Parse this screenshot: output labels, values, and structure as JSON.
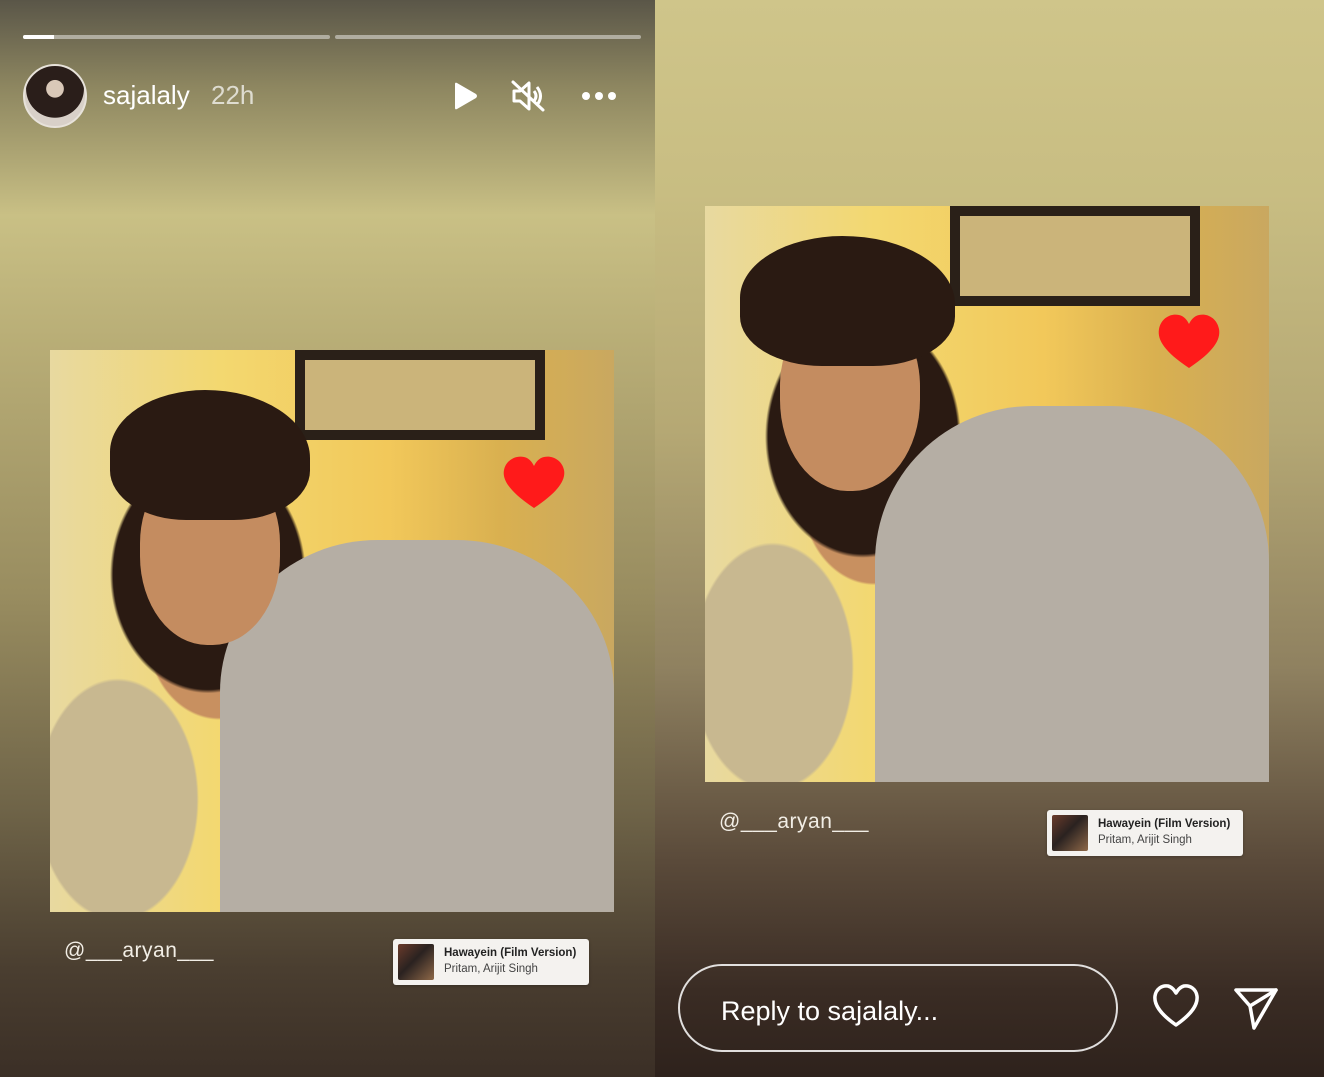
{
  "story": {
    "username": "sajalaly",
    "time": "22h",
    "progress": [
      0.1,
      0.0
    ]
  },
  "post": {
    "mention": "@___aryan___",
    "music": {
      "title": "Hawayein (Film Version)",
      "artist": "Pritam, Arijit Singh"
    }
  },
  "reply": {
    "placeholder": "Reply to sajalaly..."
  },
  "icons": {
    "play": "play-icon",
    "mute": "speaker-muted-icon",
    "more": "more-horizontal-icon",
    "heart_sticker": "heart-icon",
    "like": "heart-outline-icon",
    "send": "send-icon"
  },
  "colors": {
    "heart": "#ff1a1a"
  }
}
